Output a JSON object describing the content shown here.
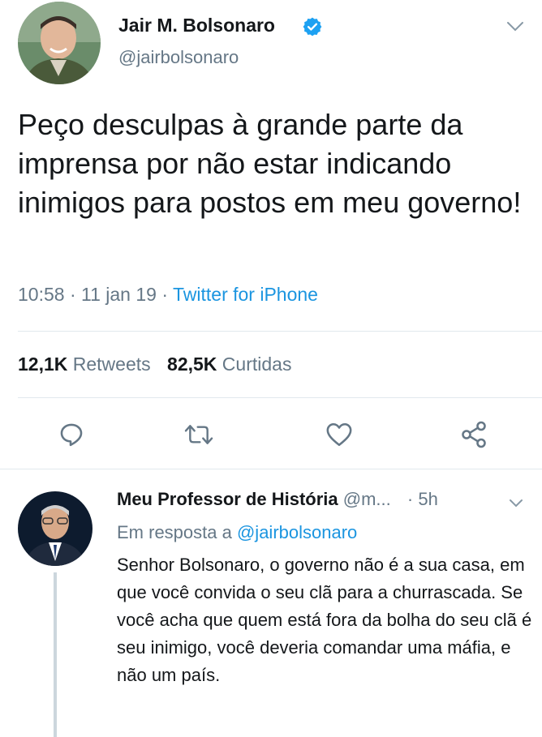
{
  "tweet": {
    "author_name": "Jair M. Bolsonaro",
    "handle": "@jairbolsonaro",
    "text": "Peço desculpas à grande parte da imprensa por não estar indicando inimigos para postos em meu governo!",
    "time": "10:58",
    "date": "11 jan 19",
    "separator": "·",
    "source": "Twitter for iPhone",
    "retweets_count": "12,1K",
    "retweets_label": "Retweets",
    "likes_count": "82,5K",
    "likes_label": "Curtidas",
    "actions": [
      "reply-icon",
      "retweet-icon",
      "like-icon",
      "share-icon"
    ]
  },
  "reply": {
    "author_name": "Meu Professor de História",
    "handle": "@m...",
    "separator": "·",
    "age": "5h",
    "in_reply_prefix": "Em resposta a",
    "in_reply_handle": "@jairbolsonaro",
    "text": "Senhor Bolsonaro, o governo não é a sua casa, em que você convida o seu clã para a churrascada. Se você acha que quem está fora da bolha do seu clã é seu inimigo, você deveria comandar uma máfia, e não um país."
  },
  "colors": {
    "accent": "#1b95e0",
    "muted": "#657786",
    "text": "#14171a",
    "divider": "#e1e8ed",
    "verified": "#1da1f2"
  }
}
